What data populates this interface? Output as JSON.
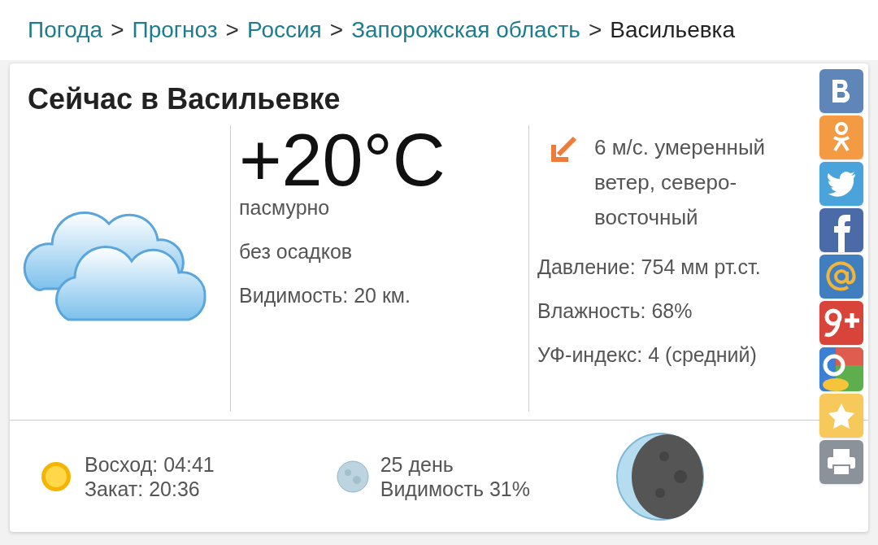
{
  "breadcrumb": {
    "separator": ">",
    "items": [
      {
        "label": "Погода",
        "link": true
      },
      {
        "label": "Прогноз",
        "link": true
      },
      {
        "label": "Россия",
        "link": true
      },
      {
        "label": "Запорожская область",
        "link": true
      },
      {
        "label": "Васильевка",
        "link": false
      }
    ]
  },
  "card": {
    "title": "Сейчас в Васильевке",
    "temperature": "+20°C",
    "conditions": [
      "пасмурно",
      "без осадков",
      "Видимость: 20 км."
    ],
    "wind": "6 м/с. умеренный ветер, северо-восточный",
    "details": [
      "Давление: 754 мм рт.ст.",
      "Влажность: 68%",
      "УФ-индекс: 4 (средний)"
    ],
    "sun": [
      "Восход: 04:41",
      "Закат: 20:36"
    ],
    "moon": [
      "25 день",
      "Видимость 31%"
    ]
  },
  "share": [
    {
      "kind": "vk"
    },
    {
      "kind": "ok"
    },
    {
      "kind": "twitter"
    },
    {
      "kind": "facebook"
    },
    {
      "kind": "mail"
    },
    {
      "kind": "gplus"
    },
    {
      "kind": "google"
    },
    {
      "kind": "bookmark"
    },
    {
      "kind": "print"
    }
  ]
}
